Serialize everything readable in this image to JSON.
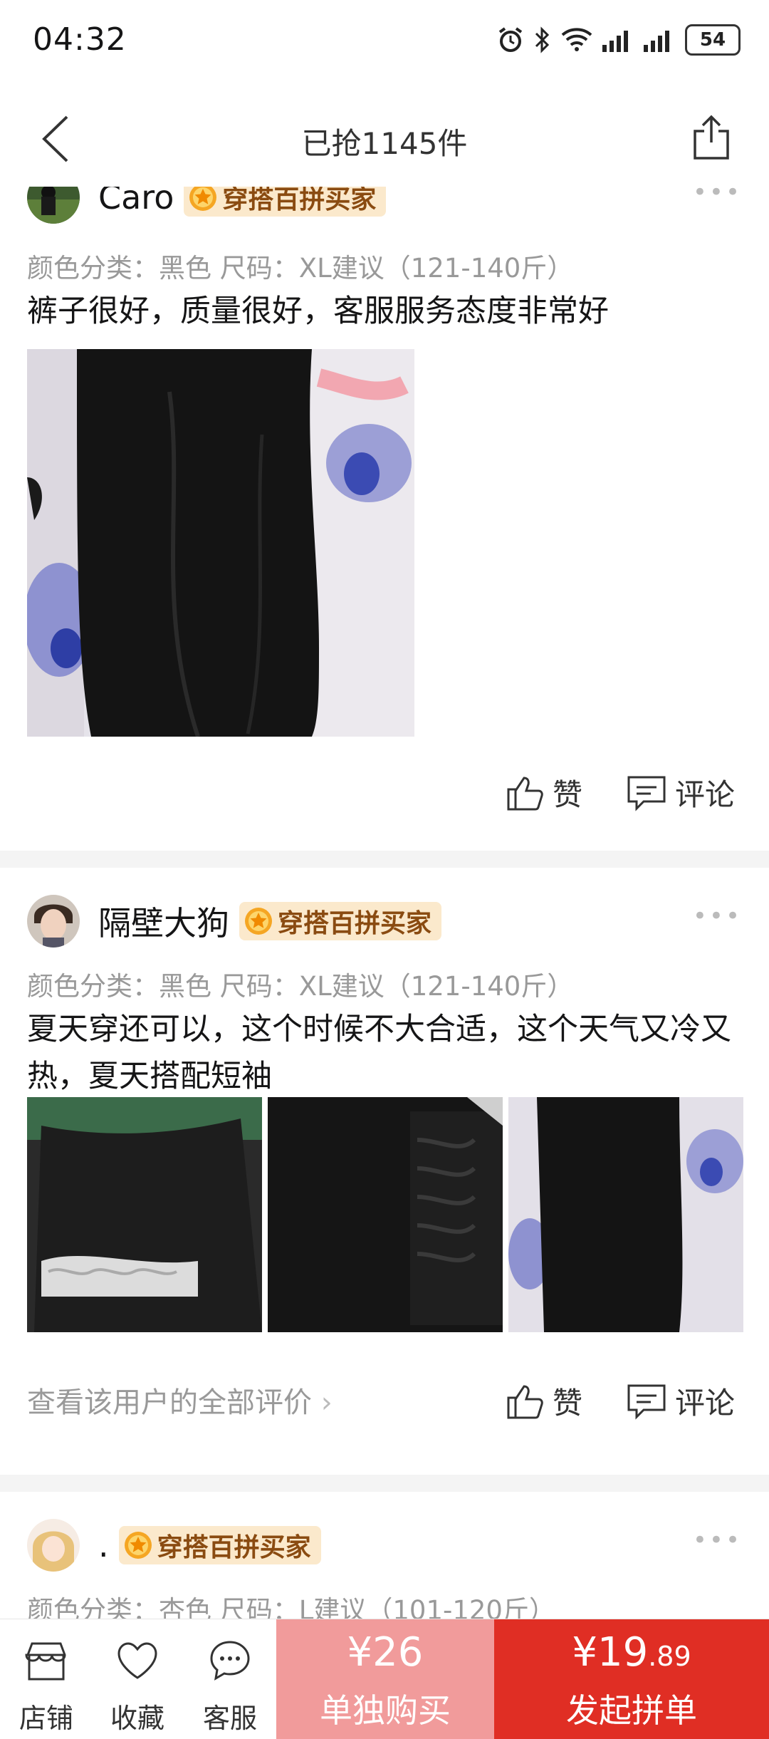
{
  "status": {
    "time": "04:32",
    "battery": "54"
  },
  "nav": {
    "title": "已抢1145件"
  },
  "reviews": [
    {
      "user": "Caro",
      "badge": "穿搭百拼买家",
      "spec": "颜色分类：黑色  尺码：XL建议（121-140斤）",
      "text": "裤子很好，质量很好，客服服务态度非常好",
      "like": "赞",
      "comment": "评论"
    },
    {
      "user": "隔壁大狗",
      "badge": "穿搭百拼买家",
      "spec": "颜色分类：黑色  尺码：XL建议（121-140斤）",
      "text": "夏天穿还可以，这个时候不大合适，这个天气又冷又热，夏天搭配短袖",
      "see_all": "查看该用户的全部评价",
      "like": "赞",
      "comment": "评论"
    },
    {
      "user": ".",
      "badge": "穿搭百拼买家",
      "spec": "颜色分类：杏色  尺码：L建议（101-120斤）"
    }
  ],
  "bottom": {
    "store": "店铺",
    "favorite": "收藏",
    "service": "客服",
    "solo_price": "¥26",
    "solo_label": "单独购买",
    "group_price_main": "¥19",
    "group_price_cents": ".89",
    "group_label": "发起拼单"
  },
  "colors": {
    "accent": "#E02E24",
    "solo": "#F19B9B",
    "badge_bg": "#FBE9CC",
    "badge_text": "#8A4B11"
  }
}
